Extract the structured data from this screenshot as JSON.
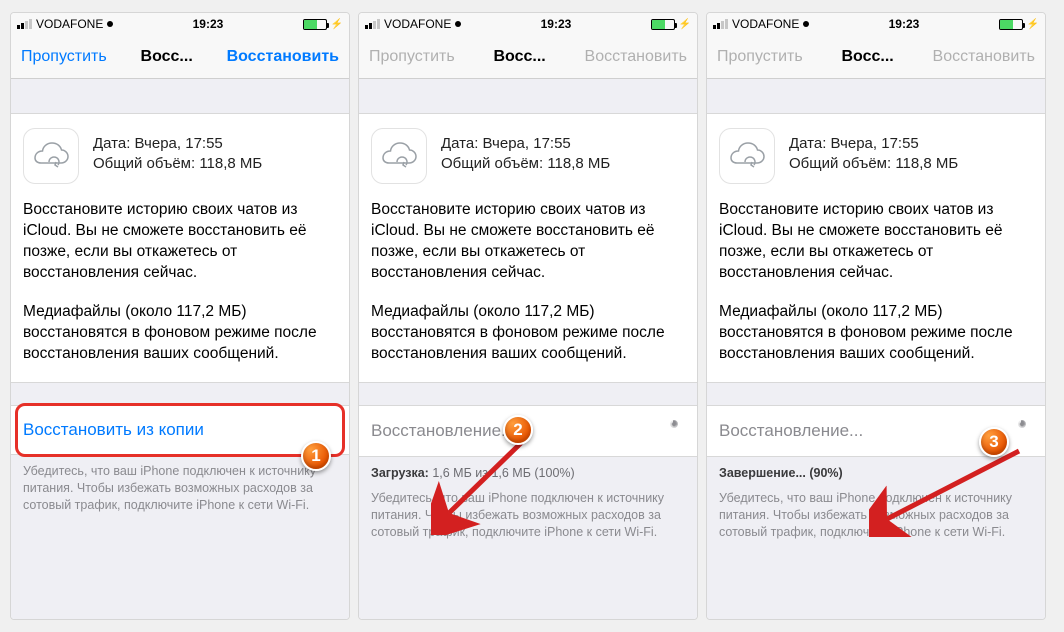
{
  "statusbar": {
    "carrier": "VODAFONE",
    "time": "19:23"
  },
  "nav": {
    "skip": "Пропустить",
    "title": "Восс...",
    "restore": "Восстановить"
  },
  "backup": {
    "date_label": "Дата: Вчера, 17:55",
    "size_label": "Общий объём: 118,8 МБ"
  },
  "body": {
    "para1": "Восстановите историю своих чатов из iCloud. Вы не сможете восстановить её позже, если вы откажетесь от восстановления сейчас.",
    "para2": "Медиафайлы (около 117,2 МБ) восстановятся в фоновом режиме после восстановления ваших сообщений."
  },
  "panels": [
    {
      "restore_label": "Восстановить из копии",
      "state": "idle",
      "progress_html": "",
      "footer": "Убедитесь, что ваш iPhone подключен к источнику питания. Чтобы избежать возможных расходов за сотовый трафик, подключите iPhone к сети Wi-Fi.",
      "badge": "1"
    },
    {
      "restore_label": "Восстановление...",
      "state": "loading",
      "progress_prefix": "Загрузка:",
      "progress_suffix": " 1,6 МБ из 1,6 МБ (100%)",
      "footer": "Убедитесь, что ваш iPhone подключен к источнику питания. Чтобы избежать возможных расходов за сотовый трафик, подключите iPhone к сети Wi-Fi.",
      "badge": "2"
    },
    {
      "restore_label": "Восстановление...",
      "state": "loading",
      "progress_prefix": "Завершение... (90%)",
      "progress_suffix": "",
      "footer": "Убедитесь, что ваш iPhone подключен к источнику питания. Чтобы избежать возможных расходов за сотовый трафик, подключите iPhone к сети Wi-Fi.",
      "badge": "3"
    }
  ]
}
